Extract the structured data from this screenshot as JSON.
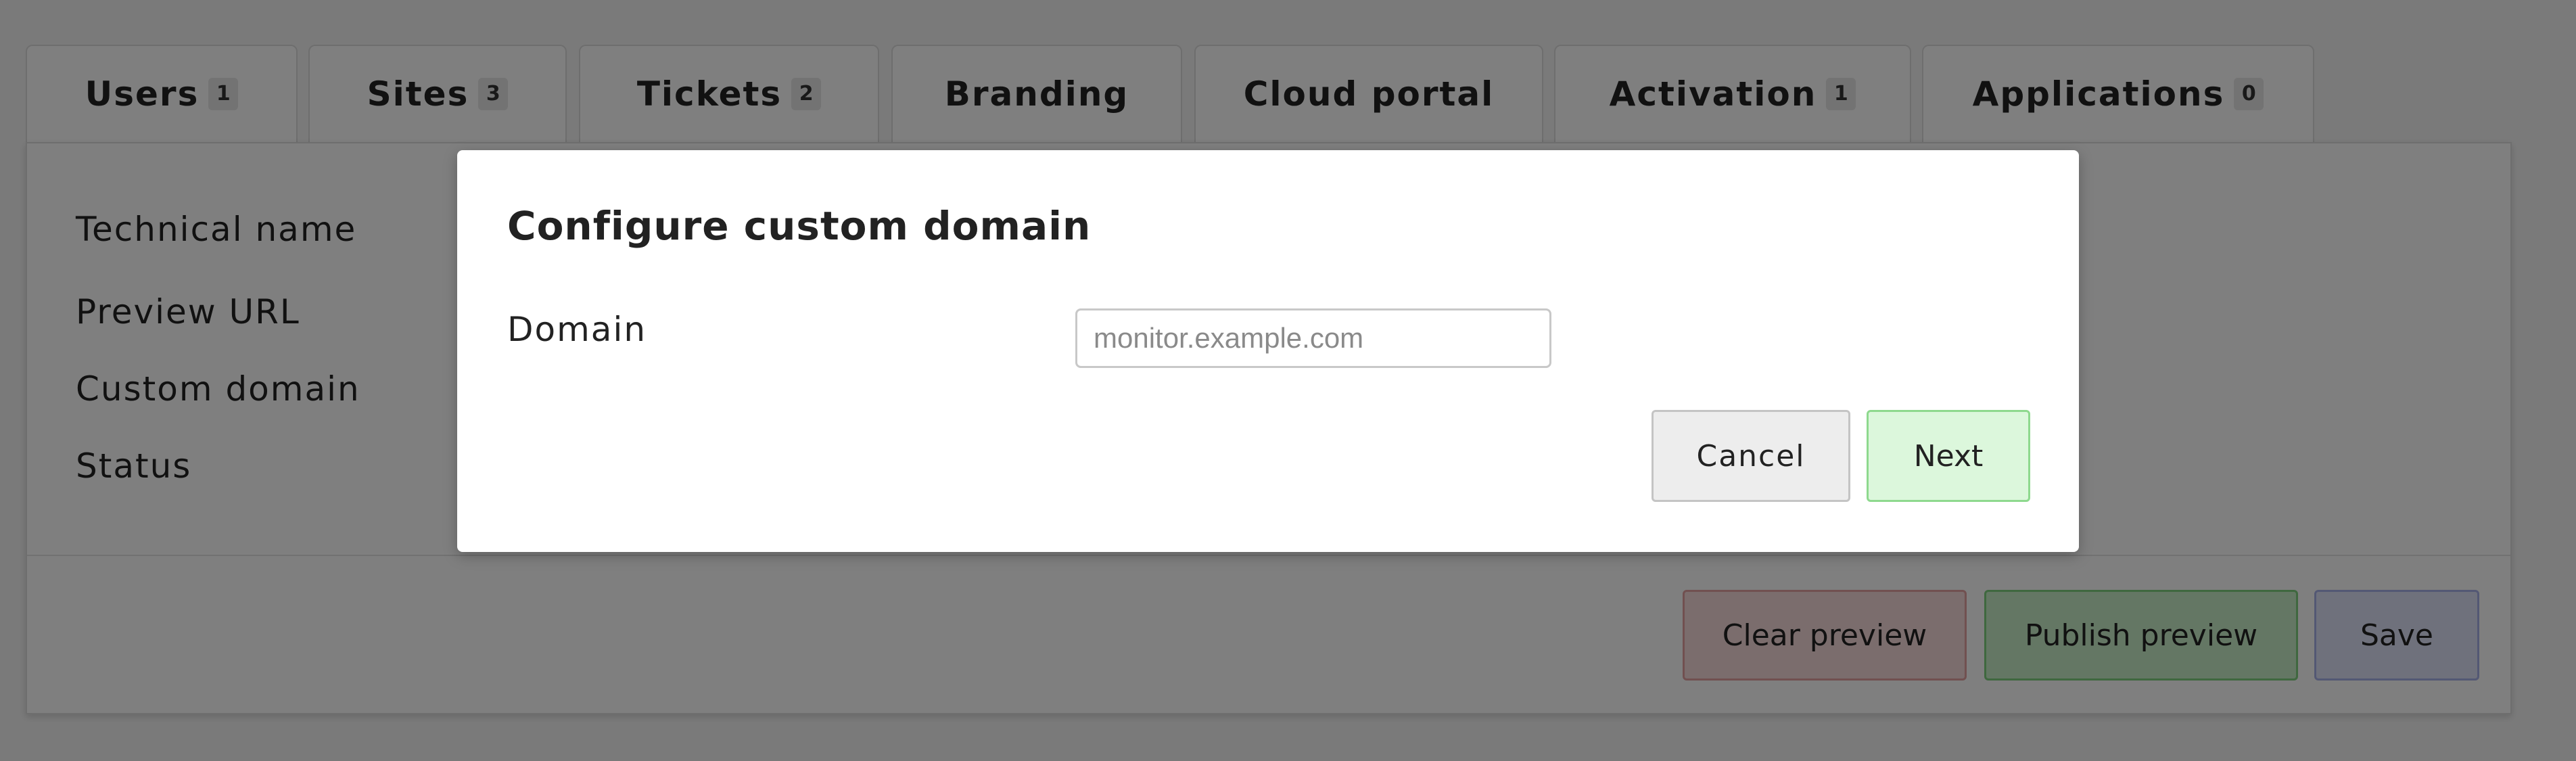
{
  "tabs": [
    {
      "label": "Users",
      "badge": "1"
    },
    {
      "label": "Sites",
      "badge": "3"
    },
    {
      "label": "Tickets",
      "badge": "2"
    },
    {
      "label": "Branding"
    },
    {
      "label": "Cloud portal"
    },
    {
      "label": "Activation",
      "badge": "1"
    },
    {
      "label": "Applications",
      "badge": "0"
    }
  ],
  "panel": {
    "fields": {
      "technical_name": "Technical name",
      "preview_url": "Preview URL",
      "custom_domain": "Custom domain",
      "status": "Status"
    },
    "buttons": {
      "clear_preview": "Clear preview",
      "publish_preview": "Publish preview",
      "save": "Save"
    }
  },
  "modal": {
    "title": "Configure custom domain",
    "domain_label": "Domain",
    "domain_value": "",
    "domain_placeholder": "monitor.example.com",
    "cancel_label": "Cancel",
    "next_label": "Next"
  },
  "colors": {
    "overlay": "#000000",
    "clear_bg": "#f6dada",
    "publish_bg": "#c8efc8",
    "save_bg": "#dfe3f8",
    "next_bg": "#dcf7dc",
    "cancel_bg": "#ededed"
  }
}
